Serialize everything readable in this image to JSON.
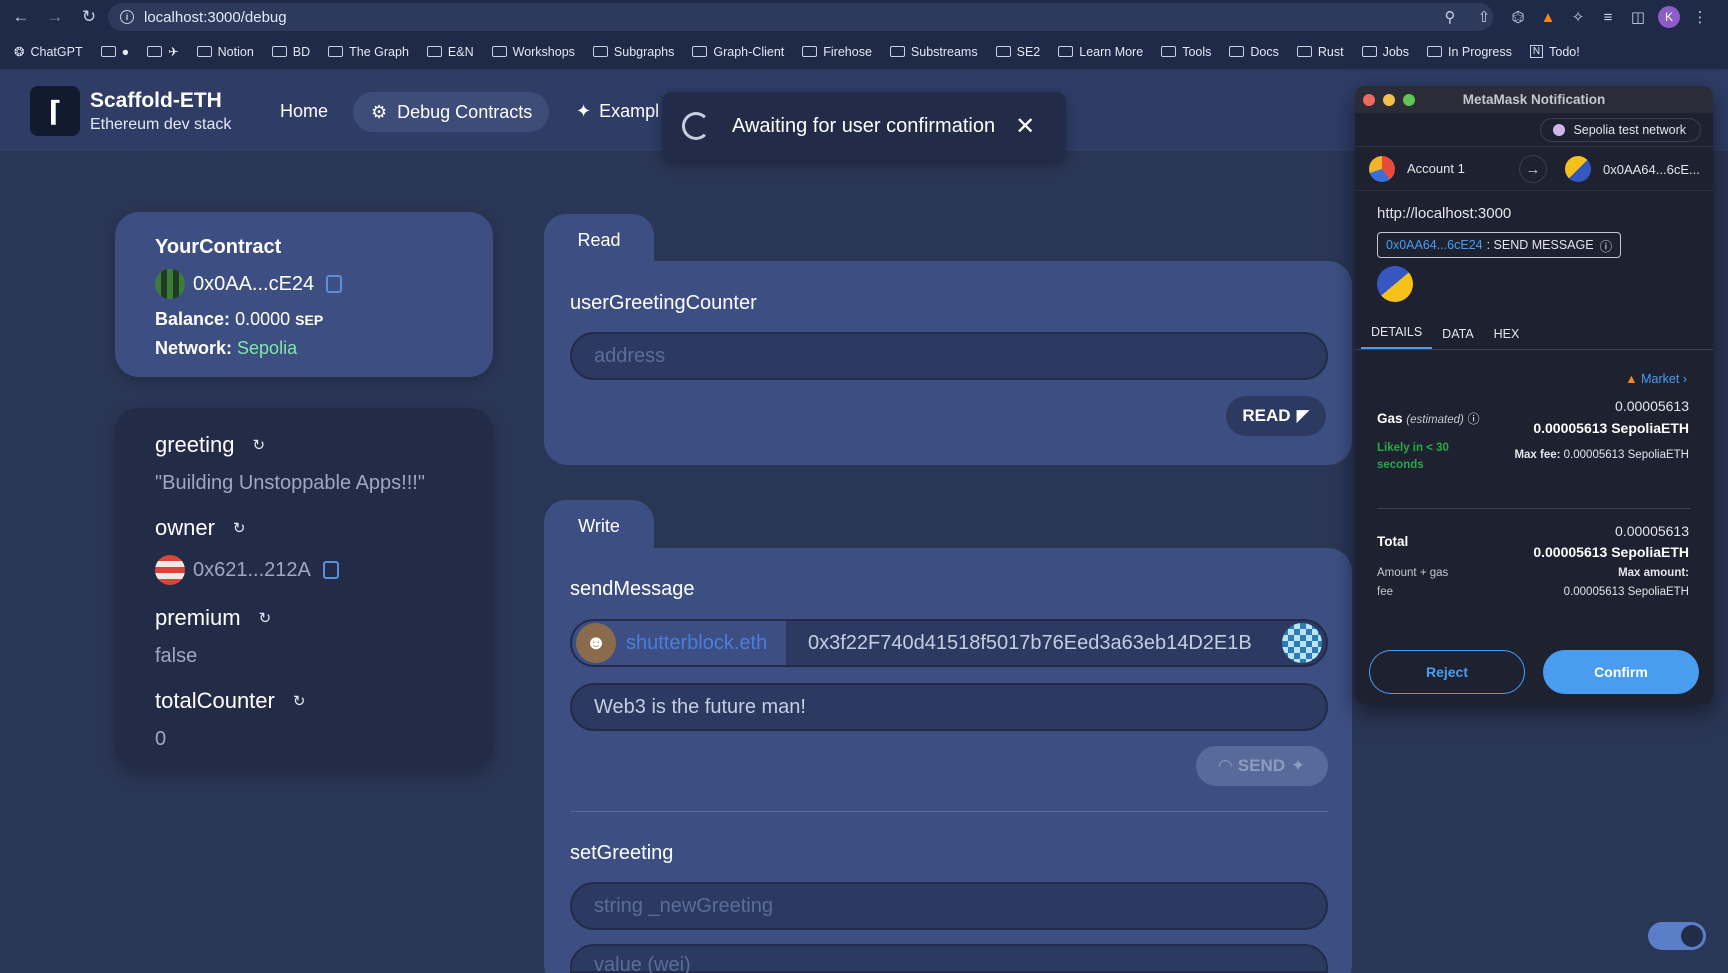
{
  "browser": {
    "url": "localhost:3000/debug",
    "bookmarks": [
      "ChatGPT",
      "",
      "",
      "Notion",
      "BD",
      "The Graph",
      "E&N",
      "Workshops",
      "Subgraphs",
      "Graph-Client",
      "Firehose",
      "Substreams",
      "SE2",
      "Learn More",
      "Tools",
      "Docs",
      "Rust",
      "Jobs",
      "In Progress",
      "Todo!"
    ],
    "profile_initial": "K"
  },
  "header": {
    "brand_title": "Scaffold-ETH",
    "brand_sub": "Ethereum dev stack",
    "nav": {
      "home": "Home",
      "debug": "Debug Contracts",
      "example": "Exampl"
    }
  },
  "toast": {
    "text": "Awaiting for user confirmation"
  },
  "contract": {
    "name": "YourContract",
    "address": "0x0AA...cE24",
    "balance_label": "Balance:",
    "balance_value": "0.0000",
    "balance_unit": "SEP",
    "network_label": "Network:",
    "network_value": "Sepolia"
  },
  "vars": {
    "greeting_label": "greeting",
    "greeting_value": "\"Building Unstoppable Apps!!!\"",
    "owner_label": "owner",
    "owner_value": "0x621...212A",
    "premium_label": "premium",
    "premium_value": "false",
    "total_label": "totalCounter",
    "total_value": "0"
  },
  "read": {
    "tab": "Read",
    "fn": "userGreetingCounter",
    "placeholder": "address",
    "button": "READ"
  },
  "write": {
    "tab": "Write",
    "fn": "sendMessage",
    "ens": "shutterblock.eth",
    "address": "0x3f22F740d41518f5017b76Eed3a63eb14D2E1B",
    "message": "Web3 is the future man!",
    "button": "SEND",
    "fn2": "setGreeting",
    "placeholder2": "string _newGreeting",
    "placeholder3": "value (wei)"
  },
  "metamask": {
    "title": "MetaMask Notification",
    "network": "Sepolia test network",
    "account": "Account 1",
    "to": "0x0AA64...6cE...",
    "origin": "http://localhost:3000",
    "method_addr": "0x0AA64...6cE24",
    "method_name": ": SEND MESSAGE",
    "tabs": [
      "DETAILS",
      "DATA",
      "HEX"
    ],
    "market": "Market",
    "gas_label": "Gas",
    "gas_est": "(estimated)",
    "gas_value": "0.00005613",
    "gas_value_eth": "0.00005613 SepoliaETH",
    "likely": "Likely in < 30",
    "seconds": "seconds",
    "max_fee_label": "Max fee:",
    "max_fee_value": "0.00005613 SepoliaETH",
    "total_label": "Total",
    "total_value": "0.00005613",
    "total_value_eth": "0.00005613 SepoliaETH",
    "amount_gas": "Amount + gas",
    "fee": "fee",
    "max_amount_label": "Max amount:",
    "max_amount_value": "0.00005613 SepoliaETH",
    "reject": "Reject",
    "confirm": "Confirm"
  }
}
